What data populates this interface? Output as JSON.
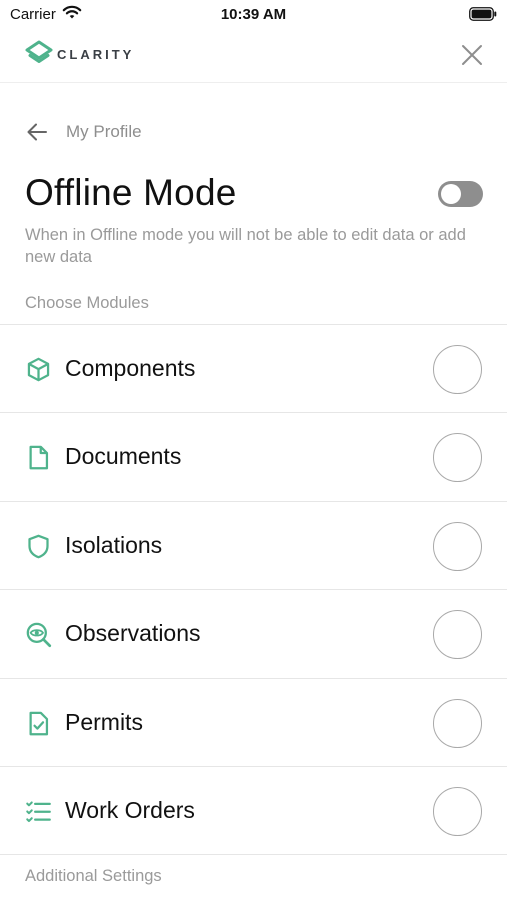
{
  "status_bar": {
    "carrier": "Carrier",
    "time": "10:39 AM"
  },
  "header": {
    "logo_text": "CLARITY",
    "brand_color": "#4fb38c",
    "close_icon": "close-icon"
  },
  "nav": {
    "back_label": "My Profile",
    "back_icon": "arrow-left-icon"
  },
  "page": {
    "title": "Offline Mode",
    "offline_enabled": false,
    "description": "When in Offline mode you will not be able to edit data or add new data"
  },
  "sections": {
    "modules_label": "Choose Modules",
    "additional_label": "Additional Settings"
  },
  "modules": [
    {
      "label": "Components",
      "icon": "cube-icon",
      "selected": false
    },
    {
      "label": "Documents",
      "icon": "document-icon",
      "selected": false
    },
    {
      "label": "Isolations",
      "icon": "shield-icon",
      "selected": false
    },
    {
      "label": "Observations",
      "icon": "eye-search-icon",
      "selected": false
    },
    {
      "label": "Permits",
      "icon": "clipboard-check-icon",
      "selected": false
    },
    {
      "label": "Work Orders",
      "icon": "checklist-icon",
      "selected": false
    }
  ]
}
